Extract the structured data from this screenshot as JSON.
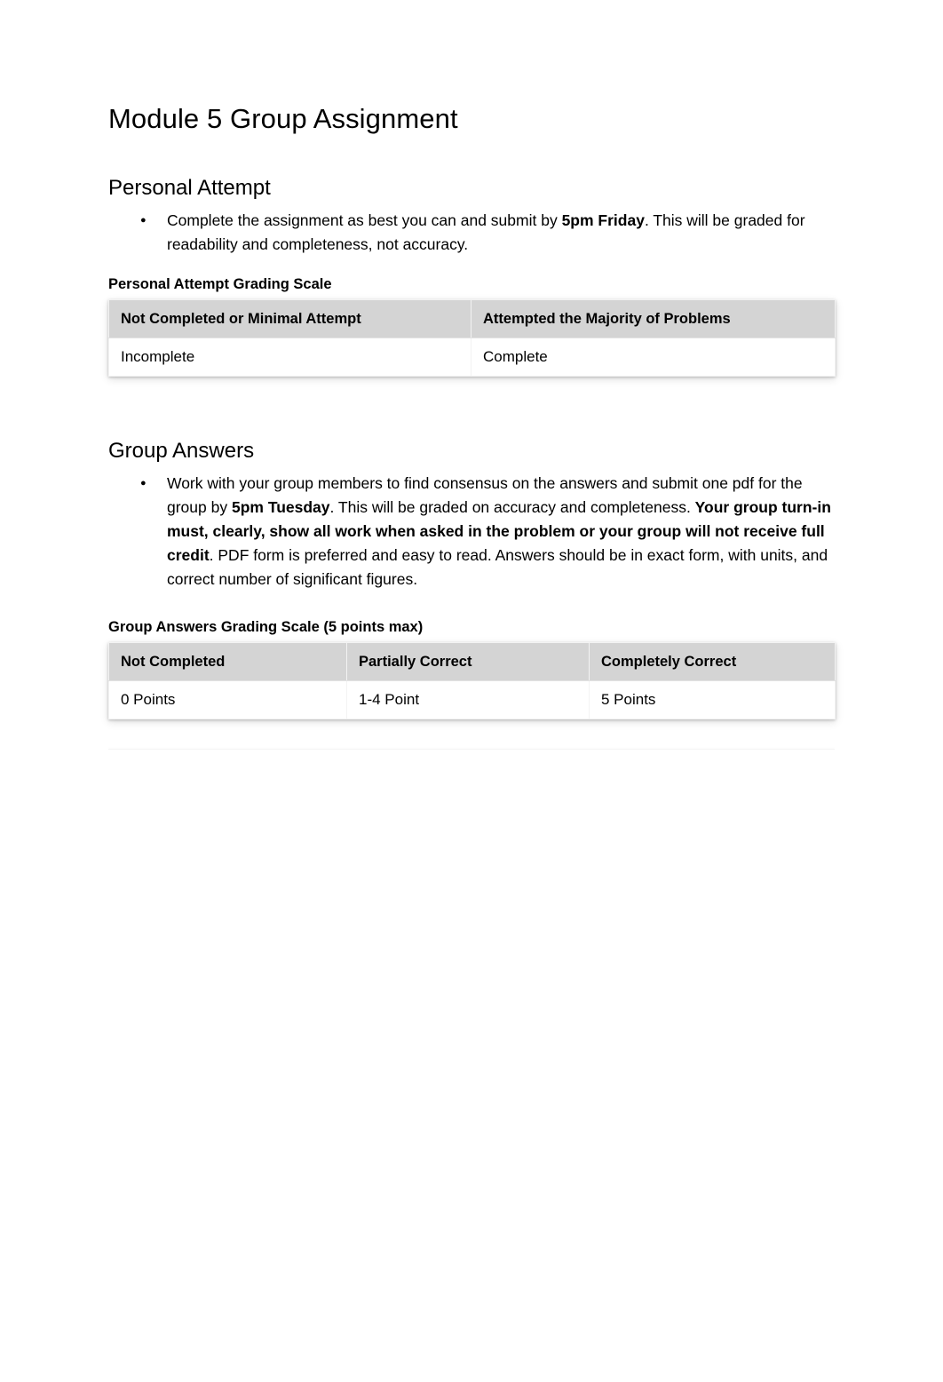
{
  "document": {
    "title": "Module 5 Group Assignment"
  },
  "sections": [
    {
      "heading": "Personal Attempt",
      "bullets": [
        {
          "parts": [
            {
              "text": "Complete the assignment as best you can and submit by ",
              "bold": false
            },
            {
              "text": "5pm Friday",
              "bold": true
            },
            {
              "text": ". This will be graded for readability and completeness, not accuracy.",
              "bold": false
            }
          ]
        }
      ],
      "table_label": "Personal Attempt Grading Scale",
      "table": {
        "headers": [
          "Not Completed or Minimal Attempt",
          "Attempted the Majority of Problems"
        ],
        "rows": [
          [
            "Incomplete",
            "Complete"
          ]
        ]
      }
    },
    {
      "heading": "Group Answers",
      "bullets": [
        {
          "parts": [
            {
              "text": "Work with your group members to find consensus on the answers and submit one pdf for the group by ",
              "bold": false
            },
            {
              "text": "5pm Tuesday",
              "bold": true
            },
            {
              "text": ". This will be graded on accuracy and completeness. ",
              "bold": false
            },
            {
              "text": "Your group turn-in must, clearly, show all work when asked in the problem or your group will not receive full credit",
              "bold": true
            },
            {
              "text": ". PDF form is preferred and easy to read. Answers should be in exact form, with units, and correct number of significant figures.",
              "bold": false
            }
          ]
        }
      ],
      "table_label": "Group Answers Grading Scale (5 points max)",
      "table": {
        "headers": [
          "Not Completed",
          "Partially Correct",
          "Completely Correct"
        ],
        "rows": [
          [
            "0 Points",
            "1-4 Point",
            "5 Points"
          ]
        ]
      }
    }
  ],
  "colors": {
    "page_background": "#ffffff",
    "table_header_background": "#d4d4d4",
    "table_body_background": "#ffffff",
    "text": "#000000"
  }
}
